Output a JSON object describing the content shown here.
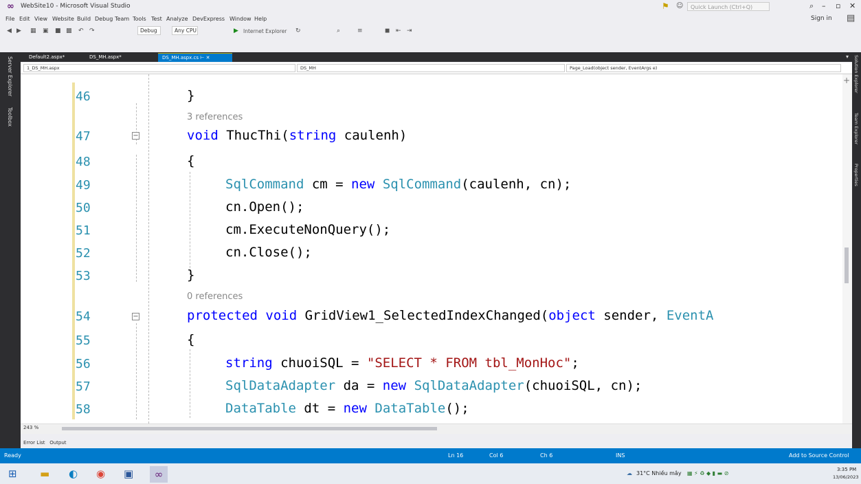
{
  "window": {
    "title": "WebSite10 - Microsoft Visual Studio",
    "quick_launch_placeholder": "Quick Launch (Ctrl+Q)",
    "sign_in": "Sign in"
  },
  "menu": [
    "File",
    "Edit",
    "View",
    "Website",
    "Build",
    "Debug",
    "Team",
    "Tools",
    "Test",
    "Analyze",
    "DevExpress",
    "Window",
    "Help"
  ],
  "toolbar": {
    "config": "Debug",
    "platform": "Any CPU",
    "run_target": "Internet Explorer"
  },
  "left_sidebar": [
    "Server Explorer",
    "Toolbox"
  ],
  "right_sidebar": [
    "Solution Explorer",
    "Team Explorer",
    "Properties"
  ],
  "tabs": [
    {
      "label": "Default2.aspx*",
      "active": false
    },
    {
      "label": "DS_MH.aspx*",
      "active": false
    },
    {
      "label": "DS_MH.aspx.cs",
      "active": true
    }
  ],
  "navbar": {
    "project": "1_DS_MH.aspx",
    "class": "DS_MH",
    "member": "Page_Load(object sender, EventArgs e)"
  },
  "code_lines": [
    {
      "num": "46",
      "text": "}",
      "ref_above": ""
    },
    {
      "num": "47",
      "text": "void ThucThi(string caulenh)",
      "ref_above": "3 references"
    },
    {
      "num": "48",
      "text": "{",
      "ref_above": ""
    },
    {
      "num": "49",
      "text": "SqlCommand cm = new SqlCommand(caulenh, cn);",
      "ref_above": ""
    },
    {
      "num": "50",
      "text": "cn.Open();",
      "ref_above": ""
    },
    {
      "num": "51",
      "text": "cm.ExecuteNonQuery();",
      "ref_above": ""
    },
    {
      "num": "52",
      "text": "cn.Close();",
      "ref_above": ""
    },
    {
      "num": "53",
      "text": "}",
      "ref_above": ""
    },
    {
      "num": "54",
      "text": "protected void GridView1_SelectedIndexChanged(object sender, EventA",
      "ref_above": "0 references"
    },
    {
      "num": "55",
      "text": "{",
      "ref_above": ""
    },
    {
      "num": "56",
      "text": "string chuoiSQL = \"SELECT * FROM tbl_MonHoc\";",
      "ref_above": ""
    },
    {
      "num": "57",
      "text": "SqlDataAdapter da = new SqlDataAdapter(chuoiSQL, cn);",
      "ref_above": ""
    },
    {
      "num": "58",
      "text": "DataTable dt = new DataTable();",
      "ref_above": ""
    }
  ],
  "zoom": "243 %",
  "output_tabs": [
    "Error List",
    "Output"
  ],
  "status": {
    "state": "Ready",
    "line": "Ln 16",
    "col": "Col 6",
    "ch": "Ch 6",
    "mode": "INS",
    "source_control": "Add to Source Control"
  },
  "taskbar": {
    "weather": "31°C Nhiều mây",
    "time": "3:35 PM",
    "date": "13/06/2023"
  },
  "colors": {
    "accent": "#007acc",
    "keyword": "#0000ff",
    "type": "#2b91af",
    "string": "#a31515"
  }
}
